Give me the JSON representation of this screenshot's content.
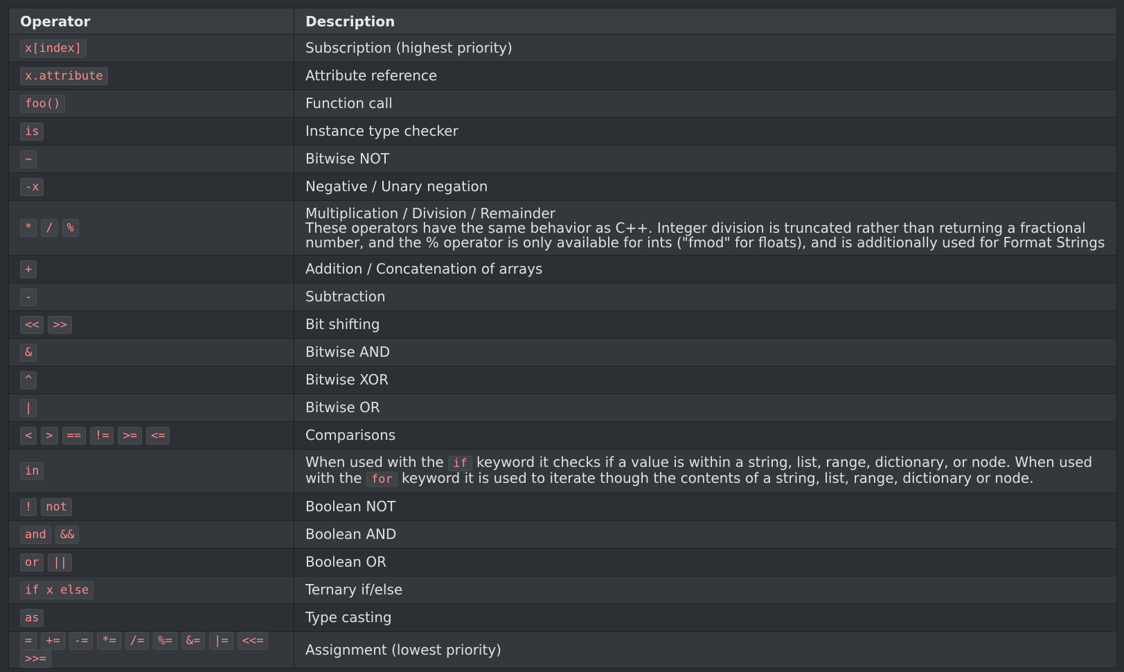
{
  "table": {
    "headers": {
      "operator": "Operator",
      "description": "Description"
    },
    "rows": [
      {
        "ops": [
          "x[index]"
        ],
        "desc": "Subscription (highest priority)"
      },
      {
        "ops": [
          "x.attribute"
        ],
        "desc": "Attribute reference"
      },
      {
        "ops": [
          "foo()"
        ],
        "desc": "Function call"
      },
      {
        "ops": [
          "is"
        ],
        "desc": "Instance type checker"
      },
      {
        "ops": [
          "~"
        ],
        "desc": "Bitwise NOT"
      },
      {
        "ops": [
          "-x"
        ],
        "desc": "Negative / Unary negation"
      },
      {
        "ops": [
          "*",
          "/",
          "%"
        ],
        "desc": "Multiplication / Division / Remainder",
        "note": "These operators have the same behavior as C++. Integer division is truncated rather than returning a fractional number, and the % operator is only available for ints (\"fmod\" for floats), and is additionally used for Format Strings"
      },
      {
        "ops": [
          "+"
        ],
        "desc": "Addition / Concatenation of arrays"
      },
      {
        "ops": [
          "-"
        ],
        "desc": "Subtraction"
      },
      {
        "ops": [
          "<<",
          ">>"
        ],
        "desc": "Bit shifting"
      },
      {
        "ops": [
          "&"
        ],
        "desc": "Bitwise AND"
      },
      {
        "ops": [
          "^"
        ],
        "desc": "Bitwise XOR"
      },
      {
        "ops": [
          "|"
        ],
        "desc": "Bitwise OR"
      },
      {
        "ops": [
          "<",
          ">",
          "==",
          "!=",
          ">=",
          "<="
        ],
        "desc": "Comparisons"
      },
      {
        "ops": [
          "in"
        ],
        "desc_parts": [
          "When used with the ",
          "if",
          " keyword it checks if a value is within a string, list, range, dictionary, or node. When used with the ",
          "for",
          " keyword it is used to iterate though the contents of a string, list, range, dictionary or node."
        ]
      },
      {
        "ops": [
          "!",
          "not"
        ],
        "desc": "Boolean NOT"
      },
      {
        "ops": [
          "and",
          "&&"
        ],
        "desc": "Boolean AND"
      },
      {
        "ops": [
          "or",
          "||"
        ],
        "desc": "Boolean OR"
      },
      {
        "ops": [
          "if x else"
        ],
        "desc": "Ternary if/else"
      },
      {
        "ops": [
          "as"
        ],
        "desc": "Type casting"
      },
      {
        "ops": [
          "=",
          "+=",
          "-=",
          "*=",
          "/=",
          "%=",
          "&=",
          "|=",
          "<<=",
          ">>="
        ],
        "desc": "Assignment (lowest priority)"
      }
    ]
  },
  "colors": {
    "background": "#2a2d32",
    "header_bg": "#393c41",
    "row_odd": "#34373c",
    "row_even": "#2c2f34",
    "code_text": "#ff8a8a",
    "code_bg": "#3f4247"
  }
}
